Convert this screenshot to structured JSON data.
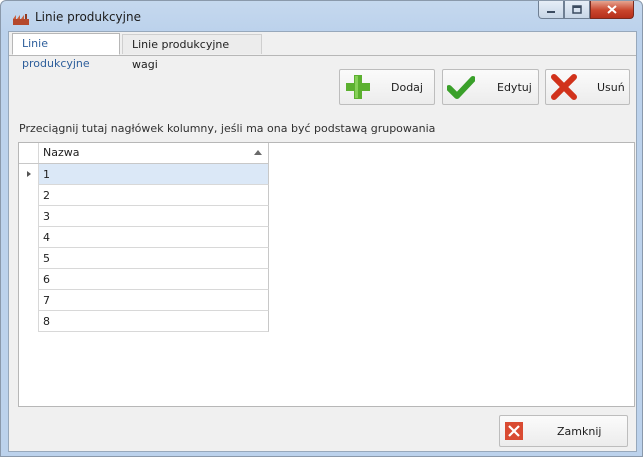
{
  "window": {
    "title": "Linie produkcyjne"
  },
  "tabs": [
    {
      "label": "Linie produkcyjne",
      "active": true
    },
    {
      "label": "Linie produkcyjne wagi",
      "active": false
    }
  ],
  "toolbar": {
    "add_label": "Dodaj",
    "edit_label": "Edytuj",
    "delete_label": "Usuń"
  },
  "grid": {
    "group_panel_text": "Przeciągnij tutaj nagłówek kolumny, jeśli ma ona być podstawą grupowania",
    "column_header": "Nazwa",
    "sort": "ascending",
    "rows": [
      "1",
      "2",
      "3",
      "4",
      "5",
      "6",
      "7",
      "8"
    ],
    "selected_row": 0
  },
  "footer": {
    "close_label": "Zamknij"
  },
  "colors": {
    "add_icon": "#5cb030",
    "edit_icon": "#3aa02a",
    "delete_icon": "#d1321b",
    "close_icon": "#d94b32",
    "active_tab_text": "#2d5e9b",
    "selected_row": "#dbe8f7"
  }
}
